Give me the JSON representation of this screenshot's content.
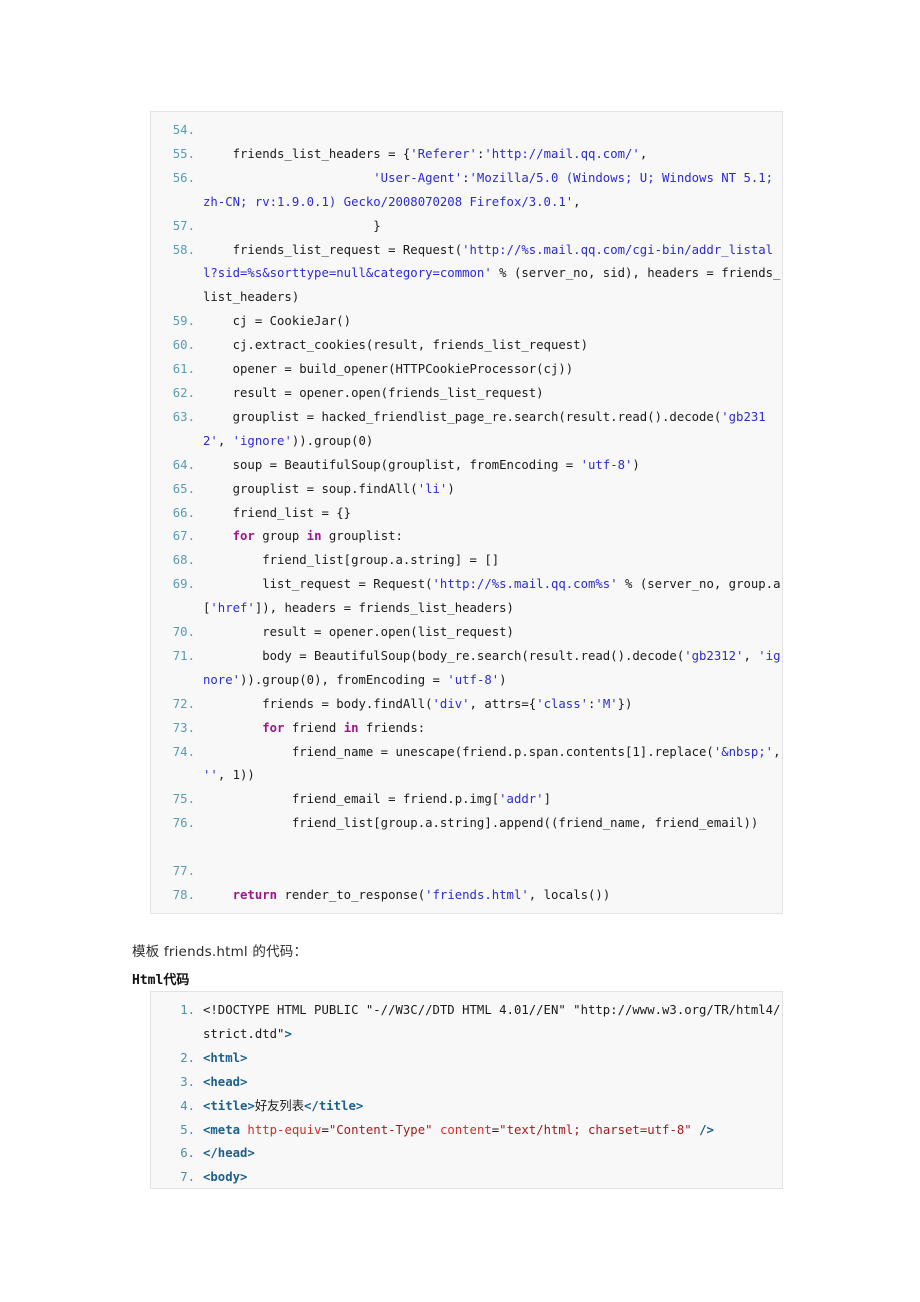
{
  "document": {
    "caption_prefix": "模板",
    "caption_filename": "friends.html",
    "caption_suffix": "的代码：",
    "html_block_title_lang": "Html",
    "html_block_title_suffix": "代码"
  },
  "colors": {
    "code_background": "#f8f8f8",
    "code_border": "#e3e3e3",
    "line_number": "#5a9bb5",
    "string": "#2b2bd4",
    "keyword": "#a0148c",
    "html_tag": "#1c5f8c",
    "html_attribute": "#d62b2b",
    "html_value": "#a01c1c",
    "text": "#1a1a1a"
  },
  "python_block": {
    "language": "python",
    "first_line_number": 54,
    "lines": [
      {
        "n": "54.",
        "tokens": []
      },
      {
        "n": "55.",
        "tokens": [
          {
            "t": "    friends_list_headers = {",
            "c": "plain"
          },
          {
            "t": "'Referer'",
            "c": "s"
          },
          {
            "t": ":",
            "c": "plain"
          },
          {
            "t": "'http://mail.qq.com/'",
            "c": "s"
          },
          {
            "t": ",",
            "c": "plain"
          }
        ]
      },
      {
        "n": "56.",
        "tokens": [
          {
            "t": "                       ",
            "c": "plain"
          },
          {
            "t": "'User-Agent'",
            "c": "s"
          },
          {
            "t": ":",
            "c": "plain"
          },
          {
            "t": "'Mozilla/5.0 (Windows; U; Windows NT 5.1; zh-CN; rv:1.9.0.1) Gecko/2008070208 Firefox/3.0.1'",
            "c": "s"
          },
          {
            "t": ",",
            "c": "plain"
          }
        ]
      },
      {
        "n": "57.",
        "tokens": [
          {
            "t": "                       }",
            "c": "plain"
          }
        ]
      },
      {
        "n": "58.",
        "tokens": [
          {
            "t": "    friends_list_request = Request(",
            "c": "plain"
          },
          {
            "t": "'http://%s.mail.qq.com/cgi-bin/addr_listall?sid=%s&sorttype=null&category=common'",
            "c": "s"
          },
          {
            "t": " % (server_no, sid), headers = friends_list_headers)",
            "c": "plain"
          }
        ]
      },
      {
        "n": "59.",
        "tokens": [
          {
            "t": "    cj = CookieJar()",
            "c": "plain"
          }
        ]
      },
      {
        "n": "60.",
        "tokens": [
          {
            "t": "    cj.extract_cookies(result, friends_list_request)",
            "c": "plain"
          }
        ]
      },
      {
        "n": "61.",
        "tokens": [
          {
            "t": "    opener = build_opener(HTTPCookieProcessor(cj))",
            "c": "plain"
          }
        ]
      },
      {
        "n": "62.",
        "tokens": [
          {
            "t": "    result = opener.open(friends_list_request)",
            "c": "plain"
          }
        ]
      },
      {
        "n": "63.",
        "tokens": [
          {
            "t": "    grouplist = hacked_friendlist_page_re.search(result.read().decode(",
            "c": "plain"
          },
          {
            "t": "'gb2312'",
            "c": "s"
          },
          {
            "t": ", ",
            "c": "plain"
          },
          {
            "t": "'ignore'",
            "c": "s"
          },
          {
            "t": ")).group(0)",
            "c": "plain"
          }
        ]
      },
      {
        "n": "64.",
        "tokens": [
          {
            "t": "    soup = BeautifulSoup(grouplist, fromEncoding = ",
            "c": "plain"
          },
          {
            "t": "'utf-8'",
            "c": "s"
          },
          {
            "t": ")",
            "c": "plain"
          }
        ]
      },
      {
        "n": "65.",
        "tokens": [
          {
            "t": "    grouplist = soup.findAll(",
            "c": "plain"
          },
          {
            "t": "'li'",
            "c": "s"
          },
          {
            "t": ")",
            "c": "plain"
          }
        ]
      },
      {
        "n": "66.",
        "tokens": [
          {
            "t": "    friend_list = {}",
            "c": "plain"
          }
        ]
      },
      {
        "n": "67.",
        "tokens": [
          {
            "t": "    ",
            "c": "plain"
          },
          {
            "t": "for",
            "c": "k"
          },
          {
            "t": " group ",
            "c": "plain"
          },
          {
            "t": "in",
            "c": "k"
          },
          {
            "t": " grouplist:",
            "c": "plain"
          }
        ]
      },
      {
        "n": "68.",
        "tokens": [
          {
            "t": "        friend_list[group.a.string] = []",
            "c": "plain"
          }
        ]
      },
      {
        "n": "69.",
        "tokens": [
          {
            "t": "        list_request = Request(",
            "c": "plain"
          },
          {
            "t": "'http://%s.mail.qq.com%s'",
            "c": "s"
          },
          {
            "t": " % (server_no, group.a[",
            "c": "plain"
          },
          {
            "t": "'href'",
            "c": "s"
          },
          {
            "t": "]), headers = friends_list_headers)",
            "c": "plain"
          }
        ]
      },
      {
        "n": "70.",
        "tokens": [
          {
            "t": "        result = opener.open(list_request)",
            "c": "plain"
          }
        ]
      },
      {
        "n": "71.",
        "tokens": [
          {
            "t": "        body = BeautifulSoup(body_re.search(result.read().decode(",
            "c": "plain"
          },
          {
            "t": "'gb2312'",
            "c": "s"
          },
          {
            "t": ", ",
            "c": "plain"
          },
          {
            "t": "'ignore'",
            "c": "s"
          },
          {
            "t": ")).group(0), fromEncoding = ",
            "c": "plain"
          },
          {
            "t": "'utf-8'",
            "c": "s"
          },
          {
            "t": ")",
            "c": "plain"
          }
        ]
      },
      {
        "n": "72.",
        "tokens": [
          {
            "t": "        friends = body.findAll(",
            "c": "plain"
          },
          {
            "t": "'div'",
            "c": "s"
          },
          {
            "t": ", attrs={",
            "c": "plain"
          },
          {
            "t": "'class'",
            "c": "s"
          },
          {
            "t": ":",
            "c": "plain"
          },
          {
            "t": "'M'",
            "c": "s"
          },
          {
            "t": "})",
            "c": "plain"
          }
        ]
      },
      {
        "n": "73.",
        "tokens": [
          {
            "t": "        ",
            "c": "plain"
          },
          {
            "t": "for",
            "c": "k"
          },
          {
            "t": " friend ",
            "c": "plain"
          },
          {
            "t": "in",
            "c": "k"
          },
          {
            "t": " friends:",
            "c": "plain"
          }
        ]
      },
      {
        "n": "74.",
        "tokens": [
          {
            "t": "            friend_name = unescape(friend.p.span.contents[1].replace(",
            "c": "plain"
          },
          {
            "t": "'&nbsp;'",
            "c": "s"
          },
          {
            "t": ", ",
            "c": "plain"
          },
          {
            "t": "''",
            "c": "s"
          },
          {
            "t": ", 1))",
            "c": "plain"
          }
        ]
      },
      {
        "n": "75.",
        "tokens": [
          {
            "t": "            friend_email = friend.p.img[",
            "c": "plain"
          },
          {
            "t": "'addr'",
            "c": "s"
          },
          {
            "t": "]",
            "c": "plain"
          }
        ]
      },
      {
        "n": "76.",
        "tokens": [
          {
            "t": "            friend_list[group.a.string].append((friend_name, friend_email))",
            "c": "plain"
          }
        ]
      },
      {
        "n": "",
        "tokens": []
      },
      {
        "n": "77.",
        "tokens": []
      },
      {
        "n": "78.",
        "tokens": [
          {
            "t": "    ",
            "c": "plain"
          },
          {
            "t": "return",
            "c": "k"
          },
          {
            "t": " render_to_response(",
            "c": "plain"
          },
          {
            "t": "'friends.html'",
            "c": "s"
          },
          {
            "t": ", locals())",
            "c": "plain"
          }
        ]
      }
    ]
  },
  "html_block": {
    "language": "html",
    "first_line_number": 1,
    "lines": [
      {
        "n": "1.",
        "tokens": [
          {
            "t": "<!DOCTYPE HTML PUBLIC \"-//W3C//DTD HTML 4.01//EN\" \"http://www.w3.org/TR/html4/strict.dtd\"",
            "c": "plain"
          },
          {
            "t": ">",
            "c": "tag"
          }
        ]
      },
      {
        "n": "2.",
        "tokens": [
          {
            "t": "<html>",
            "c": "tag"
          }
        ]
      },
      {
        "n": "3.",
        "tokens": [
          {
            "t": "<head>",
            "c": "tag"
          }
        ]
      },
      {
        "n": "4.",
        "tokens": [
          {
            "t": "<title>",
            "c": "tag"
          },
          {
            "t": "好友列表",
            "c": "cjk"
          },
          {
            "t": "</title>",
            "c": "tag"
          }
        ]
      },
      {
        "n": "5.",
        "tokens": [
          {
            "t": "<meta ",
            "c": "tag"
          },
          {
            "t": "http-equiv",
            "c": "att"
          },
          {
            "t": "=",
            "c": "plain"
          },
          {
            "t": "\"Content-Type\"",
            "c": "val"
          },
          {
            "t": " ",
            "c": "plain"
          },
          {
            "t": "content",
            "c": "att"
          },
          {
            "t": "=",
            "c": "plain"
          },
          {
            "t": "\"text/html; charset=utf-8\"",
            "c": "val"
          },
          {
            "t": " ",
            "c": "plain"
          },
          {
            "t": "/>",
            "c": "tag"
          }
        ]
      },
      {
        "n": "6.",
        "tokens": [
          {
            "t": "</head>",
            "c": "tag"
          }
        ]
      },
      {
        "n": "7.",
        "tokens": [
          {
            "t": "<body>",
            "c": "tag"
          }
        ]
      }
    ]
  }
}
